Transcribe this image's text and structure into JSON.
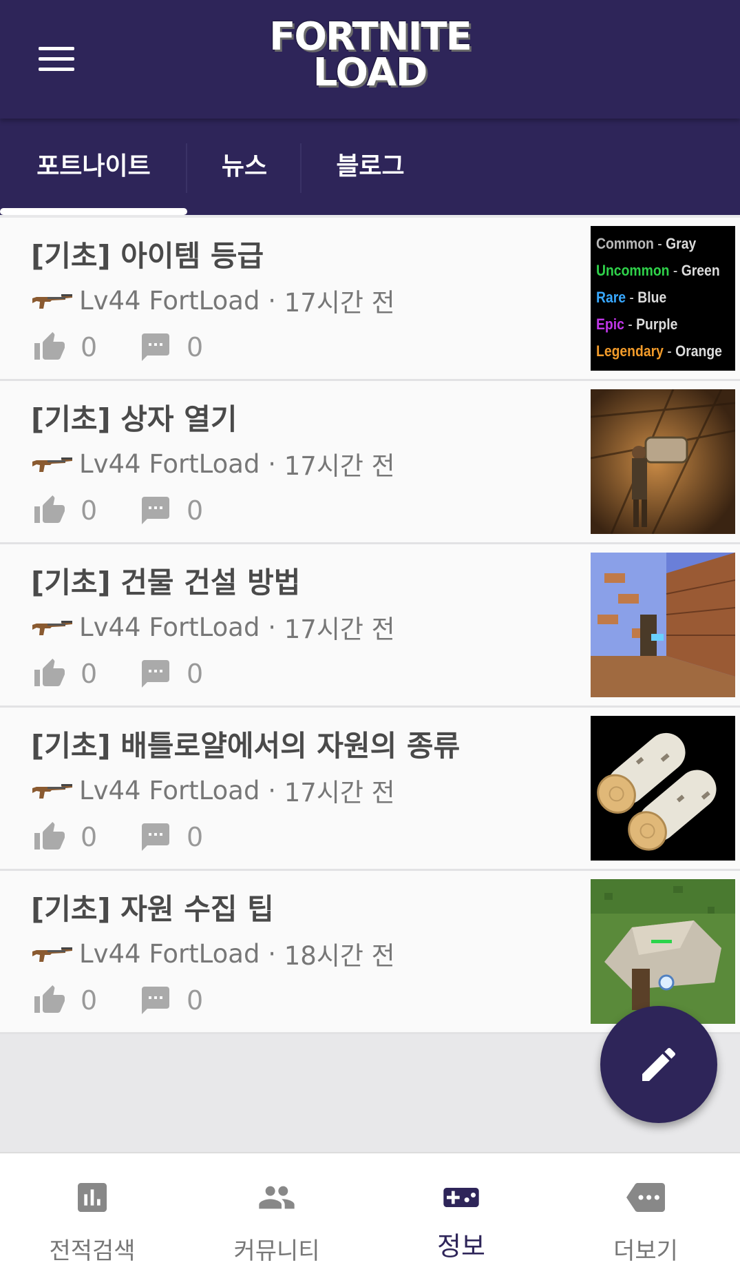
{
  "header": {
    "menu_icon": "hamburger-menu-icon",
    "logo_line1": "FORTNITE",
    "logo_line2": "LOAD"
  },
  "tabs": [
    {
      "label": "포트나이트",
      "active": true
    },
    {
      "label": "뉴스",
      "active": false
    },
    {
      "label": "블로그",
      "active": false
    }
  ],
  "posts": [
    {
      "title": "[기초] 아이템 등급",
      "author": "Lv44 FortLoad",
      "time": "17시간 전",
      "likes": "0",
      "comments": "0"
    },
    {
      "title": "[기초] 상자 열기",
      "author": "Lv44 FortLoad",
      "time": "17시간 전",
      "likes": "0",
      "comments": "0"
    },
    {
      "title": "[기초] 건물 건설 방법",
      "author": "Lv44 FortLoad",
      "time": "17시간 전",
      "likes": "0",
      "comments": "0"
    },
    {
      "title": "[기초] 배틀로얄에서의 자원의 종류",
      "author": "Lv44 FortLoad",
      "time": "17시간 전",
      "likes": "0",
      "comments": "0"
    },
    {
      "title": "[기초] 자원 수집 팁",
      "author": "Lv44 FortLoad",
      "time": "18시간 전",
      "likes": "0",
      "comments": "0"
    }
  ],
  "rarity_thumb": {
    "rows": [
      {
        "rarity": "Common",
        "color_name": "Gray",
        "color": "#b8b8b8"
      },
      {
        "rarity": "Uncommon",
        "color_name": "Green",
        "color": "#2fd24a"
      },
      {
        "rarity": "Rare",
        "color_name": "Blue",
        "color": "#38a8ff"
      },
      {
        "rarity": "Epic",
        "color_name": "Purple",
        "color": "#c036e8"
      },
      {
        "rarity": "Legendary",
        "color_name": "Orange",
        "color": "#f29b2a"
      }
    ]
  },
  "bottom_nav": [
    {
      "label": "전적검색",
      "icon": "bar-chart-icon",
      "active": false
    },
    {
      "label": "커뮤니티",
      "icon": "people-icon",
      "active": false
    },
    {
      "label": "정보",
      "icon": "gamepad-icon",
      "active": true
    },
    {
      "label": "더보기",
      "icon": "more-tag-icon",
      "active": false
    }
  ],
  "fab_icon": "pencil-icon",
  "colors": {
    "primary": "#2e2559",
    "background": "#fafafa"
  }
}
